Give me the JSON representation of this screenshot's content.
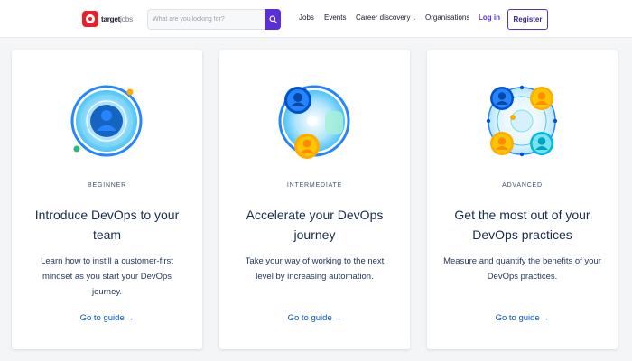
{
  "header": {
    "logo_primary": "target",
    "logo_secondary": "jobs",
    "search_placeholder": "What are you looking for?",
    "nav": {
      "jobs": "Jobs",
      "events": "Events",
      "career": "Career discovery",
      "organisations": "Organisations",
      "login": "Log in",
      "register": "Register"
    }
  },
  "cards": [
    {
      "level": "BEGINNER",
      "title": "Introduce DevOps to your team",
      "description": "Learn how to instill a customer-first mindset as you start your DevOps journey.",
      "link": "Go to guide",
      "arrow": "→"
    },
    {
      "level": "INTERMEDIATE",
      "title": "Accelerate your DevOps journey",
      "description": "Take your way of working to the next level by increasing automation.",
      "link": "Go to guide",
      "arrow": "→"
    },
    {
      "level": "ADVANCED",
      "title": "Get the most out of your DevOps practices",
      "description": "Measure and quantify the benefits of your DevOps practices.",
      "link": "Go to guide",
      "arrow": "→"
    }
  ],
  "colors": {
    "brand_purple": "#5a2fd8",
    "link_blue": "#0052cc",
    "logo_red": "#e8202a"
  }
}
